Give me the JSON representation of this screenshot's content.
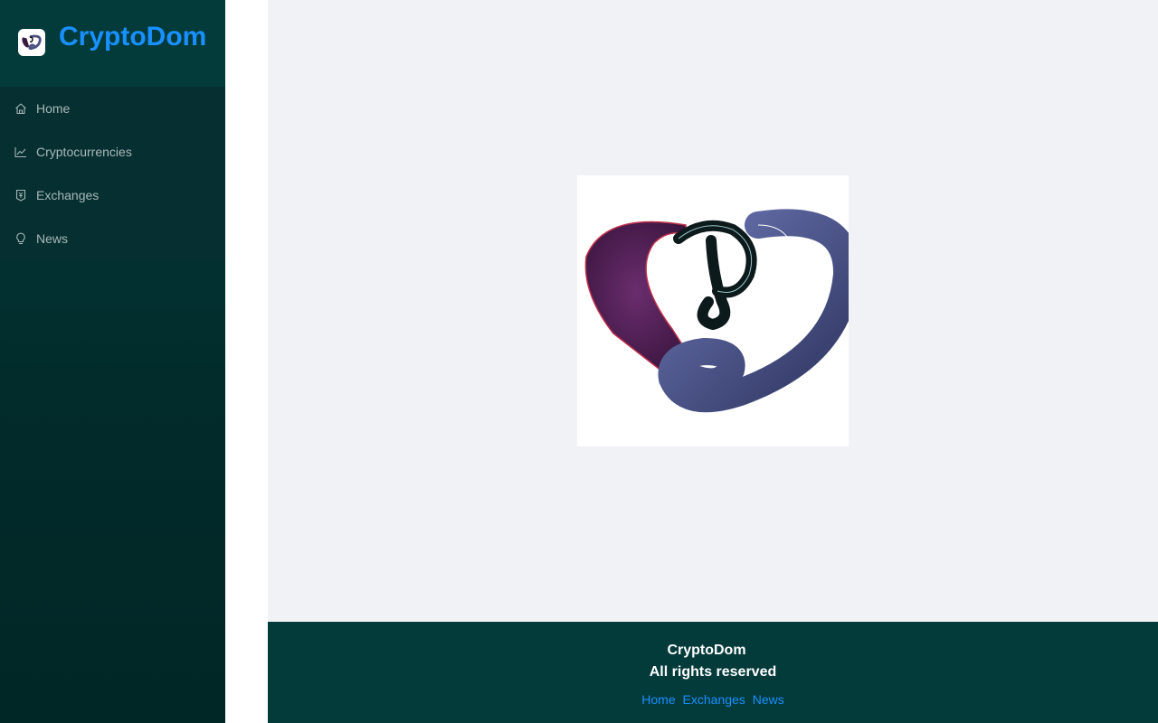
{
  "brand": {
    "title": "CryptoDom",
    "logo_icon": "cryptodom-logo-icon"
  },
  "sidebar": {
    "items": [
      {
        "label": "Home",
        "icon": "home-icon"
      },
      {
        "label": "Cryptocurrencies",
        "icon": "line-chart-icon"
      },
      {
        "label": "Exchanges",
        "icon": "money-collect-icon"
      },
      {
        "label": "News",
        "icon": "bulb-icon"
      }
    ]
  },
  "main": {
    "loader_image": "cryptodom-logo-icon"
  },
  "footer": {
    "title": "CryptoDom",
    "rights": "All rights reserved",
    "links": [
      "Home",
      "Exchanges",
      "News"
    ]
  },
  "colors": {
    "sidebar_bg": "#033a3a",
    "accent": "#1890ff",
    "main_bg": "#f0f2f5",
    "footer_bg": "#033a3a"
  }
}
